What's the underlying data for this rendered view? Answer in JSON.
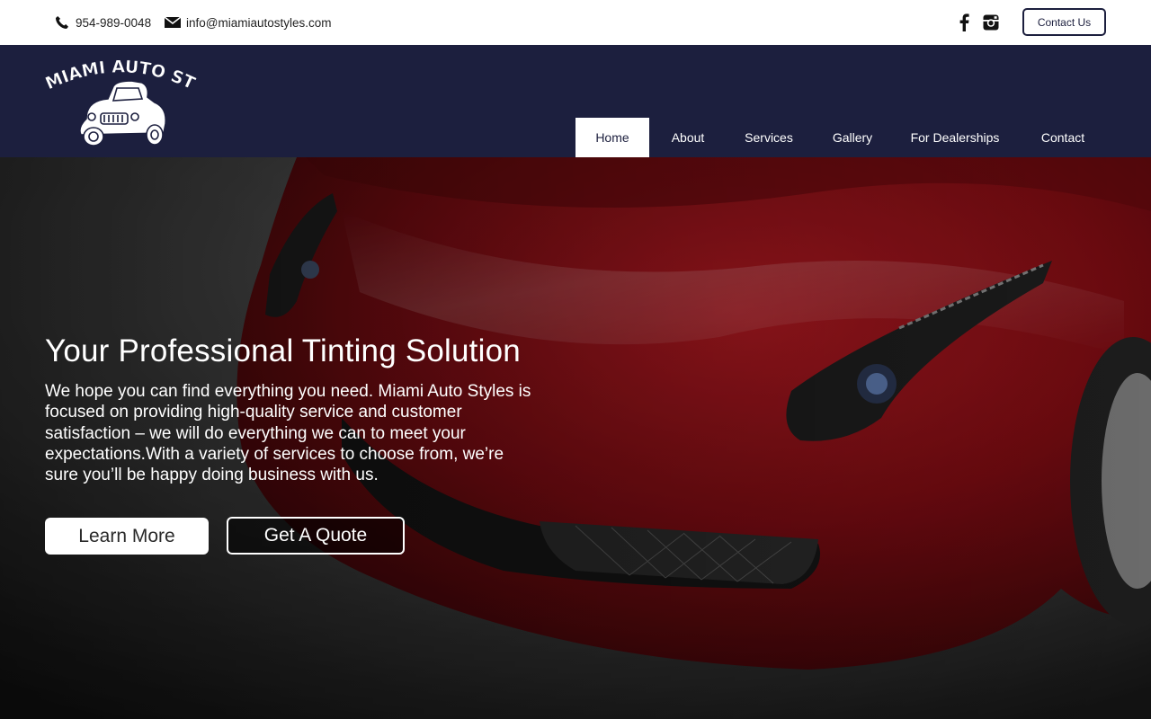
{
  "topbar": {
    "phone": "954-989-0048",
    "email": "info@miamiautostyles.com",
    "contact_button": "Contact Us",
    "social_icons": [
      "facebook-icon",
      "instagram-icon"
    ]
  },
  "header": {
    "logo_text": "MIAMI AUTO STYLES",
    "nav": [
      {
        "label": "Home",
        "active": true
      },
      {
        "label": "About",
        "active": false
      },
      {
        "label": "Services",
        "active": false
      },
      {
        "label": "Gallery",
        "active": false
      },
      {
        "label": "For Dealerships",
        "active": false
      },
      {
        "label": "Contact",
        "active": false
      }
    ]
  },
  "hero": {
    "title": "Your Professional Tinting Solution",
    "body": "We hope you can find everything you need. Miami Auto Styles is focused on providing high-quality service and customer satisfaction – we will do everything we can to meet your expectations.With a variety of services to choose from, we’re sure you’ll be happy doing business with us.",
    "learn_more": "Learn More",
    "get_quote": "Get A Quote"
  },
  "colors": {
    "header_navy": "#1c1f3e",
    "car_red": "#8e0f16",
    "white": "#ffffff"
  }
}
